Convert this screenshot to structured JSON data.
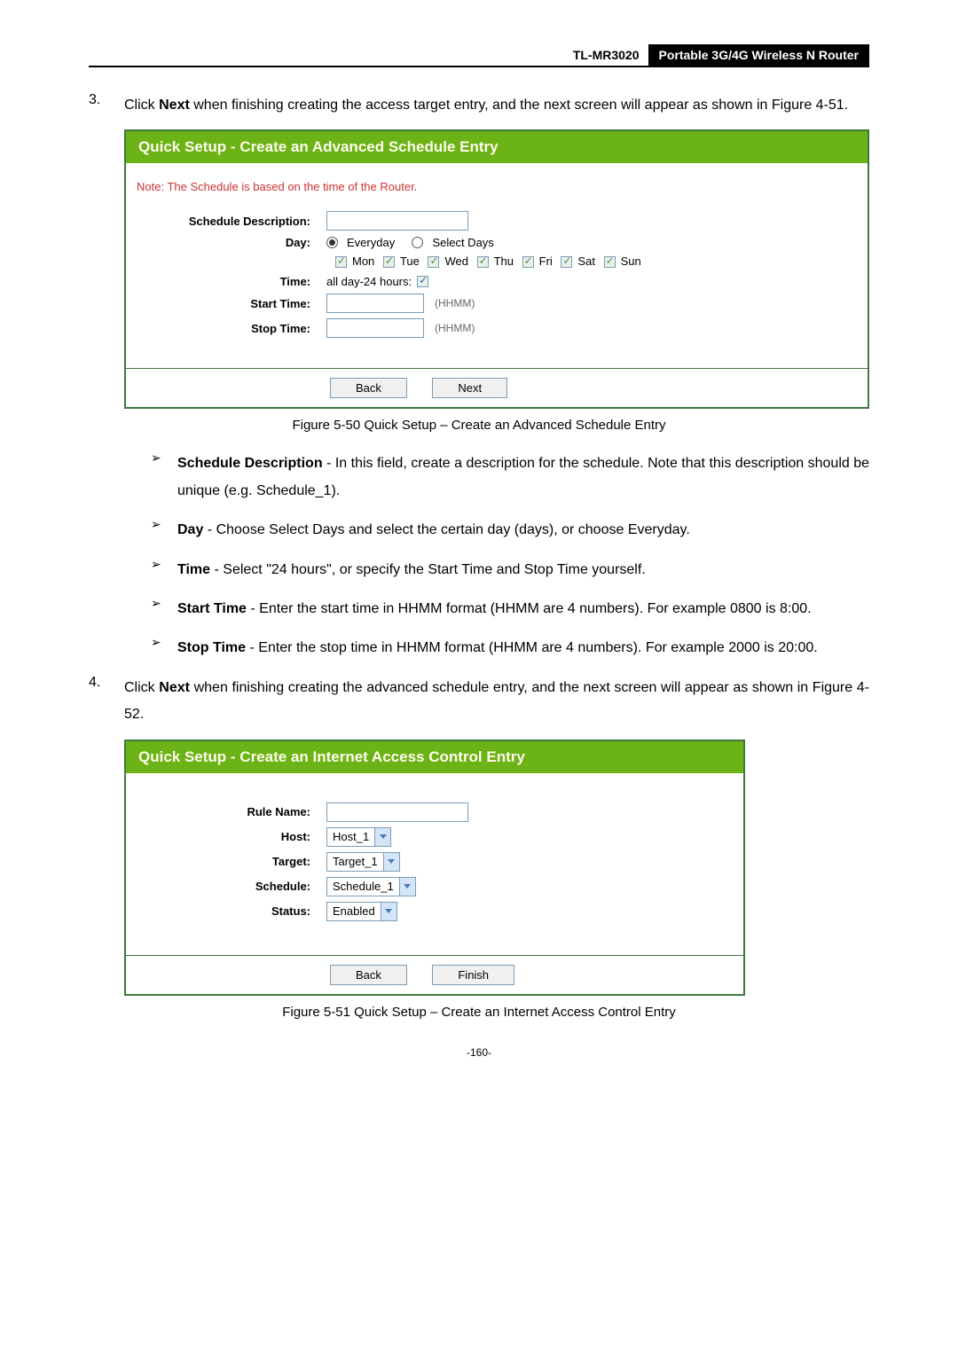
{
  "header": {
    "model": "TL-MR3020",
    "desc": "Portable 3G/4G Wireless N Router"
  },
  "step3": {
    "num": "3.",
    "text_a": "Click ",
    "text_b": "Next",
    "text_c": " when finishing creating the access target entry, and the next screen will appear as shown in Figure 4-51."
  },
  "fig1": {
    "title": "Quick Setup - Create an Advanced Schedule Entry",
    "note": "Note: The Schedule is based on the time of the Router.",
    "labels": {
      "schedule_desc": "Schedule Description:",
      "day": "Day:",
      "time": "Time:",
      "start": "Start Time:",
      "stop": "Stop Time:"
    },
    "everyday": "Everyday",
    "selectdays": "Select Days",
    "days": {
      "mon": "Mon",
      "tue": "Tue",
      "wed": "Wed",
      "thu": "Thu",
      "fri": "Fri",
      "sat": "Sat",
      "sun": "Sun"
    },
    "allday": "all day-24 hours:",
    "hhmm": "(HHMM)",
    "back": "Back",
    "next": "Next",
    "caption": "Figure 5-50    Quick Setup – Create an Advanced Schedule Entry"
  },
  "bullets": {
    "b1a": "Schedule Description",
    "b1b": " - In this field, create a description for the schedule. Note that this description should be unique (e.g. Schedule_1).",
    "b2a": "Day",
    "b2b": " - Choose Select Days and select the certain day (days), or choose Everyday.",
    "b3a": "Time",
    "b3b": " - Select \"24 hours\", or specify the Start Time and Stop Time yourself.",
    "b4a": "Start Time",
    "b4b": " - Enter the start time in HHMM format (HHMM are 4 numbers). For example 0800 is 8:00.",
    "b5a": "Stop Time",
    "b5b": " - Enter the stop time in HHMM format (HHMM are 4 numbers). For example 2000 is 20:00."
  },
  "step4": {
    "num": "4.",
    "text_a": "Click ",
    "text_b": "Next",
    "text_c": " when finishing creating the advanced schedule entry, and the next screen will appear as shown in Figure 4-52."
  },
  "fig2": {
    "title": "Quick Setup - Create an Internet Access Control Entry",
    "labels": {
      "rule": "Rule Name:",
      "host": "Host:",
      "target": "Target:",
      "schedule": "Schedule:",
      "status": "Status:"
    },
    "host": "Host_1",
    "target": "Target_1",
    "schedule": "Schedule_1",
    "status": "Enabled",
    "back": "Back",
    "finish": "Finish",
    "caption": "Figure 5-51   Quick Setup – Create an Internet Access Control Entry"
  },
  "pagenum": "-160-"
}
